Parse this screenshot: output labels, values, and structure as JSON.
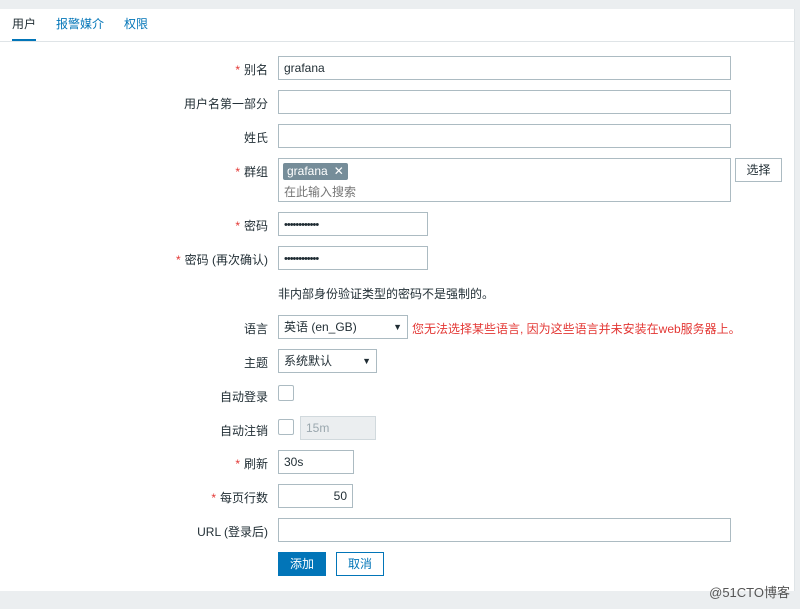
{
  "tabs": [
    {
      "label": "用户",
      "active": true
    },
    {
      "label": "报警媒介",
      "active": false
    },
    {
      "label": "权限",
      "active": false
    }
  ],
  "form": {
    "alias": {
      "label": "别名",
      "required": true,
      "value": "grafana"
    },
    "name": {
      "label": "用户名第一部分",
      "value": ""
    },
    "surname": {
      "label": "姓氏",
      "value": ""
    },
    "groups": {
      "label": "群组",
      "required": true,
      "chips": [
        "grafana"
      ],
      "search_placeholder": "在此输入搜索",
      "select_button": "选择"
    },
    "password": {
      "label": "密码",
      "required": true,
      "value": "••••••••••••"
    },
    "password_confirm": {
      "label": "密码 (再次确认)",
      "required": true,
      "value": "••••••••••••"
    },
    "password_hint": "非内部身份验证类型的密码不是强制的。",
    "language": {
      "label": "语言",
      "value": "英语 (en_GB)",
      "warning": "您无法选择某些语言, 因为这些语言并未安装在web服务器上。"
    },
    "theme": {
      "label": "主题",
      "value": "系统默认"
    },
    "autologin": {
      "label": "自动登录",
      "checked": false
    },
    "autologout": {
      "label": "自动注销",
      "checked": false,
      "value": "15m"
    },
    "refresh": {
      "label": "刷新",
      "required": true,
      "value": "30s"
    },
    "rows_per_page": {
      "label": "每页行数",
      "required": true,
      "value": "50"
    },
    "url": {
      "label": "URL (登录后)",
      "value": ""
    },
    "buttons": {
      "add": "添加",
      "cancel": "取消"
    }
  },
  "watermark": "@51CTO博客",
  "colors": {
    "accent": "#0275b8",
    "required": "#e33734",
    "chip": "#768d99"
  },
  "icons": {
    "dropdown": "triangle-down",
    "chip_remove": "cross"
  }
}
